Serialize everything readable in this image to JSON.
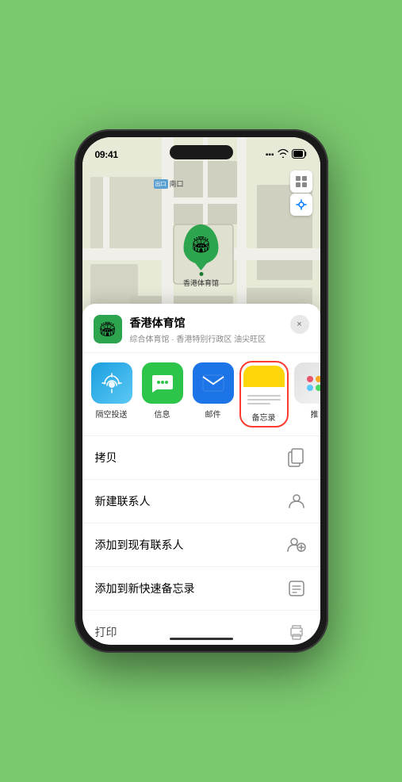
{
  "status_bar": {
    "time": "09:41",
    "signal": "▪▪▪",
    "wifi": "wifi",
    "battery": "battery"
  },
  "map": {
    "label_tag": "出口",
    "label_text": "南口",
    "venue_name_marker": "香港体育馆"
  },
  "venue_header": {
    "name": "香港体育馆",
    "subtitle": "综合体育馆 · 香港特别行政区 油尖旺区",
    "close_label": "×"
  },
  "share_row": {
    "items": [
      {
        "id": "airdrop",
        "label": "隔空投送",
        "type": "airdrop"
      },
      {
        "id": "messages",
        "label": "信息",
        "type": "messages"
      },
      {
        "id": "mail",
        "label": "邮件",
        "type": "mail"
      },
      {
        "id": "notes",
        "label": "备忘录",
        "type": "notes"
      },
      {
        "id": "more",
        "label": "推",
        "type": "more"
      }
    ]
  },
  "action_items": [
    {
      "id": "copy",
      "text": "拷贝",
      "icon": "copy"
    },
    {
      "id": "new-contact",
      "text": "新建联系人",
      "icon": "person"
    },
    {
      "id": "add-existing",
      "text": "添加到现有联系人",
      "icon": "person-add"
    },
    {
      "id": "add-notes",
      "text": "添加到新快速备忘录",
      "icon": "note"
    },
    {
      "id": "print",
      "text": "打印",
      "icon": "printer"
    }
  ]
}
